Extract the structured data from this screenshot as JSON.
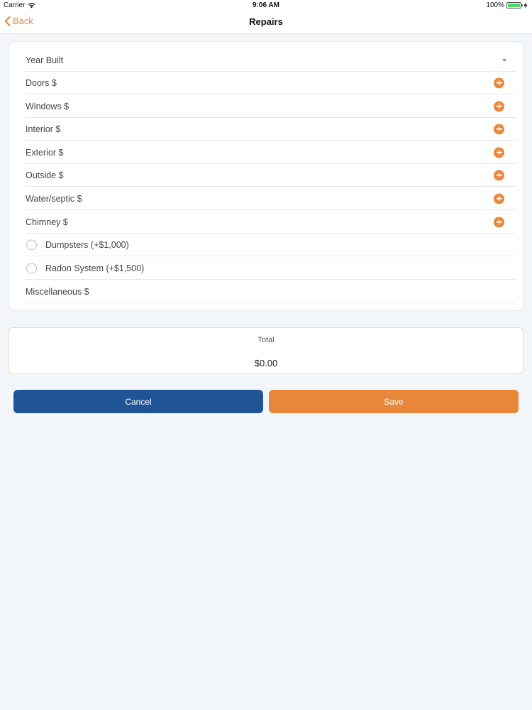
{
  "status_bar": {
    "carrier": "Carrier",
    "time": "9:06 AM",
    "battery": "100%"
  },
  "nav": {
    "back_label": "Back",
    "title": "Repairs"
  },
  "form": {
    "rows": [
      {
        "label": "Year Built",
        "control": "dropdown"
      },
      {
        "label": "Doors $",
        "control": "add"
      },
      {
        "label": "Windows $",
        "control": "add"
      },
      {
        "label": "Interior $",
        "control": "add"
      },
      {
        "label": "Exterior $",
        "control": "add"
      },
      {
        "label": "Outside $",
        "control": "add"
      },
      {
        "label": "Water/septic $",
        "control": "add"
      },
      {
        "label": "Chimney $",
        "control": "add"
      },
      {
        "label": "Dumpsters (+$1,000)",
        "control": "radio"
      },
      {
        "label": "Radon System (+$1,500)",
        "control": "radio"
      },
      {
        "label": "Miscellaneous $",
        "control": "none"
      }
    ]
  },
  "total": {
    "label": "Total",
    "value": "$0.00"
  },
  "actions": {
    "cancel_label": "Cancel",
    "save_label": "Save"
  },
  "colors": {
    "accent": "#e8863a",
    "primary": "#1f5597",
    "background": "#f3f6f9"
  }
}
